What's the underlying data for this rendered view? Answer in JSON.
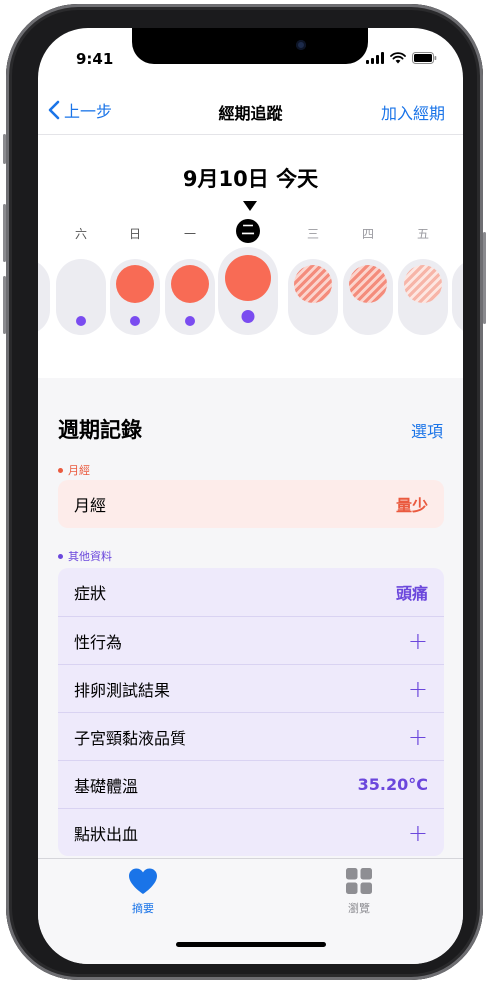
{
  "status_bar": {
    "time": "9:41"
  },
  "nav": {
    "back_label": "上一步",
    "title": "經期追蹤",
    "add_label": "加入經期"
  },
  "calendar": {
    "date_label": "9月10日 今天",
    "weekdays": [
      "六",
      "日",
      "一",
      "二",
      "三",
      "四",
      "五"
    ],
    "selected_weekday": "二"
  },
  "cycle_log": {
    "title": "週期記錄",
    "options_label": "選項",
    "period": {
      "section_label": "月經",
      "row_label": "月經",
      "row_value": "量少"
    },
    "other": {
      "section_label": "其他資料",
      "rows": [
        {
          "label": "症狀",
          "value": "頭痛"
        },
        {
          "label": "性行為",
          "value": "+"
        },
        {
          "label": "排卵測試結果",
          "value": "+"
        },
        {
          "label": "子宮頸黏液品質",
          "value": "+"
        },
        {
          "label": "基礎體溫",
          "value": "35.20°C"
        },
        {
          "label": "點狀出血",
          "value": "+"
        }
      ]
    }
  },
  "tabbar": {
    "summary": {
      "label": "摘要",
      "icon": "heart-icon"
    },
    "browse": {
      "label": "瀏覽",
      "icon": "grid-icon"
    }
  },
  "colors": {
    "accent_blue": "#1a74e8",
    "period_red": "#f86b55",
    "purple": "#6b47dc",
    "period_card_bg": "#fdecea",
    "other_card_bg": "#eeeafb"
  }
}
